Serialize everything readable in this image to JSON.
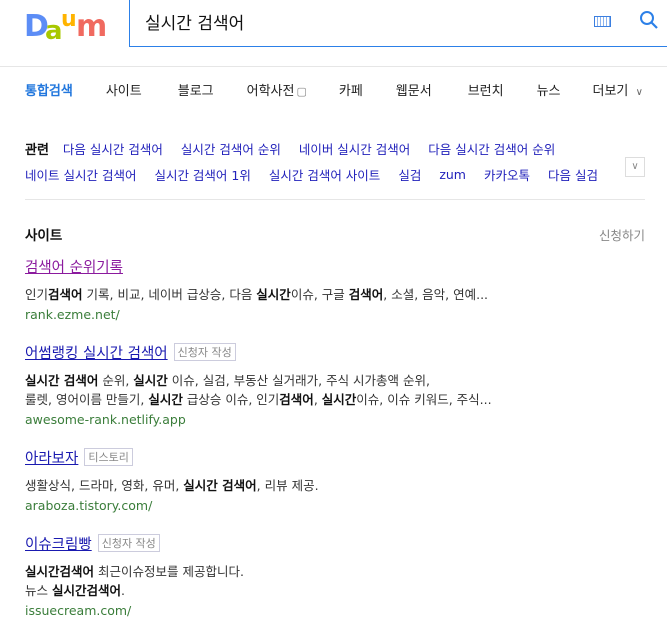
{
  "logo": {
    "text": "Daum",
    "colors": [
      "#5c8df6",
      "#a8c800",
      "#ffb400",
      "#f06a60"
    ]
  },
  "search": {
    "value": "실시간 검색어",
    "accent": "#2c80e8"
  },
  "tabs": [
    {
      "label": "통합검색",
      "active": true
    },
    {
      "label": "사이트"
    },
    {
      "label": "블로그"
    },
    {
      "label": "어학사전"
    },
    {
      "label": "카페"
    },
    {
      "label": "웹문서"
    },
    {
      "label": "브런치"
    },
    {
      "label": "뉴스"
    },
    {
      "label": "더보기"
    }
  ],
  "related": {
    "label": "관련",
    "rows": [
      [
        "다음 실시간 검색어",
        "실시간 검색어 순위",
        "네이버 실시간 검색어",
        "다음 실시간 검색어 순위"
      ],
      [
        "네이트 실시간 검색어",
        "실시간 검색어 1위",
        "실시간 검색어 사이트",
        "실검",
        "zum",
        "카카오톡",
        "다음 실검"
      ]
    ]
  },
  "section": {
    "title": "사이트",
    "apply": "신청하기"
  },
  "results": [
    {
      "title": "검색어 순위기록",
      "visited": true,
      "badge": null,
      "desc": [
        [
          {
            "t": "인기"
          },
          {
            "t": "검색어",
            "b": true
          },
          {
            "t": " 기록, 비교, 네이버 급상승, 다음 "
          },
          {
            "t": "실시간",
            "b": true
          },
          {
            "t": "이슈, 구글 "
          },
          {
            "t": "검색어",
            "b": true
          },
          {
            "t": ", 소셜, 음악, 연예..."
          }
        ]
      ],
      "url": "rank.ezme.net/"
    },
    {
      "title": "어썸랭킹 실시간 검색어",
      "visited": false,
      "badge": "신청자 작성",
      "desc": [
        [
          {
            "t": "실시간 검색어",
            "b": true
          },
          {
            "t": " 순위, "
          },
          {
            "t": "실시간",
            "b": true
          },
          {
            "t": " 이슈, 실검, 부동산 실거래가, 주식 시가총액 순위,"
          }
        ],
        [
          {
            "t": "룰렛, 영어이름 만들기, "
          },
          {
            "t": "실시간",
            "b": true
          },
          {
            "t": " 급상승 이슈, 인기"
          },
          {
            "t": "검색어",
            "b": true
          },
          {
            "t": ", "
          },
          {
            "t": "실시간",
            "b": true
          },
          {
            "t": "이슈, 이슈 키워드, 주식..."
          }
        ]
      ],
      "url": "awesome-rank.netlify.app"
    },
    {
      "title": "아라보자",
      "visited": false,
      "badge": "티스토리",
      "desc": [
        [
          {
            "t": "생활상식, 드라마, 영화, 유머, "
          },
          {
            "t": "실시간 검색어",
            "b": true
          },
          {
            "t": ", 리뷰 제공."
          }
        ]
      ],
      "url": "araboza.tistory.com/"
    },
    {
      "title": "이슈크림빵",
      "visited": false,
      "badge": "신청자 작성",
      "desc": [
        [
          {
            "t": "실시간검색어",
            "b": true
          },
          {
            "t": " 최근이슈정보를 제공합니다."
          }
        ],
        [
          {
            "t": "뉴스 "
          },
          {
            "t": "실시간검색어",
            "b": true
          },
          {
            "t": "."
          }
        ]
      ],
      "url": "issuecream.com/"
    }
  ]
}
